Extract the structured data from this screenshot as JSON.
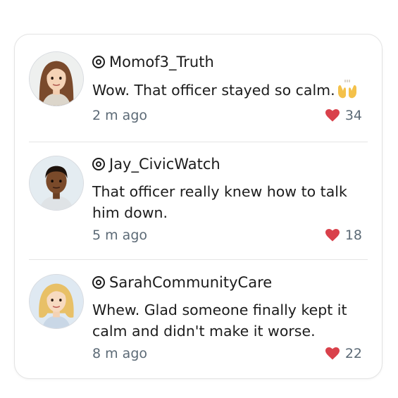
{
  "comments": [
    {
      "handle": "Momof3_Truth",
      "text": "Wow. That officer stayed so calm.",
      "emoji": "raising-hands-emoji",
      "time": "2 m ago",
      "likes": "34",
      "avatar": "avatar-woman-brown-hair"
    },
    {
      "handle": "Jay_CivicWatch",
      "text": "That officer really knew how to talk him down.",
      "time": "5 m ago",
      "likes": "18",
      "avatar": "avatar-man-dark-skin"
    },
    {
      "handle": "SarahCommunityCare",
      "text": "Whew. Glad someone finally kept it calm and didn't make it worse.",
      "time": "8 m ago",
      "likes": "22",
      "avatar": "avatar-woman-blonde-hair"
    }
  ],
  "colors": {
    "heart": "#d9414b",
    "meta_text": "#5c6a76",
    "body_text": "#1c1c1c",
    "divider": "#e5e5e5"
  }
}
